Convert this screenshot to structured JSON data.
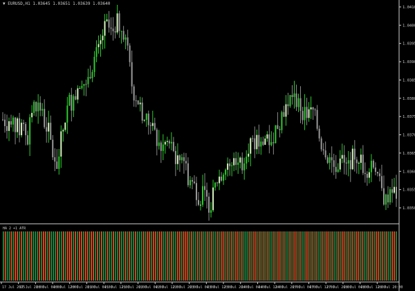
{
  "window": {
    "header_line": "▼ EURUSD,H1  1.03645 1.03651 1.03639 1.03640",
    "sub_header": "HA 2  +1  ATR"
  },
  "colors": {
    "background": "#000000",
    "bull": "#2ecc2e",
    "bull_light": "#d8f7c0",
    "bear_bar": "#ff5a2a",
    "bull_bar": "#2a9d4e",
    "axis": "#cfcfcf"
  },
  "price_axis": {
    "labels": [
      "1.0410",
      "1.0400",
      "1.0395",
      "1.0390",
      "1.0385",
      "1.0380",
      "1.0375",
      "1.0370",
      "1.0365",
      "1.0360",
      "1.0355",
      "1.0350"
    ]
  },
  "time_axis": {
    "labels": [
      "17 Jul 2015",
      "17 Jul 20:00",
      "20 Jul 04:00",
      "20 Jul 12:00",
      "20 Jul 20:00",
      "21 Jul 04:00",
      "21 Jul 12:00",
      "21 Jul 20:00",
      "22 Jul 04:00",
      "22 Jul 12:00",
      "22 Jul 20:00",
      "23 Jul 04:00",
      "23 Jul 12:00",
      "23 Jul 20:00",
      "24 Jul 04:00",
      "24 Jul 12:00",
      "24 Jul 20:00",
      "27 Jul 04:00",
      "27 Jul 12:00",
      "27 Jul 20:00",
      "28 Jul 04:00",
      "28 Jul 12:00",
      "28 Jul 20:00"
    ]
  },
  "chart_data": [
    {
      "type": "line",
      "ylim": [
        1.0348,
        1.0414
      ],
      "y": [
        1.0379,
        1.0378,
        1.038,
        1.0377,
        1.0376,
        1.0378,
        1.0372,
        1.0383,
        1.0384,
        1.0382,
        1.0378,
        1.0375,
        1.0368,
        1.0365,
        1.0373,
        1.038,
        1.0385,
        1.0384,
        1.039,
        1.0392,
        1.0388,
        1.0395,
        1.0398,
        1.04,
        1.0406,
        1.0408,
        1.0405,
        1.0409,
        1.0408,
        1.0406,
        1.0398,
        1.0388,
        1.0386,
        1.0382,
        1.0379,
        1.0378,
        1.0375,
        1.0372,
        1.037,
        1.0372,
        1.0371,
        1.0368,
        1.0366,
        1.0369,
        1.0362,
        1.036,
        1.0358,
        1.0355,
        1.0356,
        1.0353,
        1.0354,
        1.036,
        1.0362,
        1.0365,
        1.0363,
        1.0366,
        1.0368,
        1.0365,
        1.037,
        1.0372,
        1.037,
        1.0373,
        1.0371,
        1.0374,
        1.0372,
        1.0376,
        1.0378,
        1.0382,
        1.0384,
        1.0386,
        1.0385,
        1.0383,
        1.0381,
        1.038,
        1.0382,
        1.0377,
        1.0372,
        1.037,
        1.0367,
        1.0365,
        1.0365,
        1.0367,
        1.0364,
        1.0366,
        1.0368,
        1.0368,
        1.0365,
        1.0364,
        1.0366,
        1.0365,
        1.0359,
        1.0355,
        1.0353,
        1.0357,
        1.0356
      ]
    },
    {
      "type": "bar",
      "values": [
        1,
        0,
        1,
        1,
        0,
        1,
        0,
        0,
        1,
        0,
        1,
        1,
        0,
        1,
        0,
        1,
        1,
        1,
        0,
        1,
        0,
        0,
        1,
        0,
        1,
        1,
        1,
        0,
        1,
        1,
        0,
        1,
        0,
        0,
        0,
        1,
        0,
        1,
        0,
        0,
        1,
        0,
        0,
        1,
        0,
        0,
        1,
        0,
        1,
        0,
        1,
        1,
        0,
        1,
        1,
        0,
        1,
        1,
        0,
        1,
        1,
        0,
        1,
        0,
        1,
        1,
        0,
        1,
        1,
        1,
        0,
        1,
        0,
        0,
        1,
        0,
        0,
        1,
        0,
        0,
        1,
        1,
        0,
        1,
        0,
        1,
        1,
        0,
        0,
        1,
        0,
        0,
        0,
        1,
        0,
        1,
        1,
        0,
        1,
        0,
        1,
        1,
        0,
        1,
        0,
        1,
        1,
        0,
        1,
        0,
        0,
        1,
        0,
        1,
        0,
        1,
        0,
        0,
        1,
        0,
        1,
        1,
        1,
        0,
        1,
        0,
        0,
        1,
        0,
        1,
        0,
        1,
        0,
        1,
        1,
        0,
        1,
        0,
        0,
        1,
        0,
        1,
        1,
        0,
        1,
        0,
        0,
        1,
        0,
        1,
        1,
        0,
        0,
        1,
        0,
        1,
        0,
        1,
        1,
        0,
        1,
        0,
        0,
        1,
        0,
        1,
        1,
        0,
        1,
        0,
        0,
        1,
        0,
        1,
        0,
        1,
        0,
        0,
        1,
        0,
        1,
        1,
        0,
        1,
        0,
        1,
        0,
        0,
        1,
        0,
        1,
        0,
        1,
        1,
        0,
        0,
        1
      ]
    }
  ]
}
